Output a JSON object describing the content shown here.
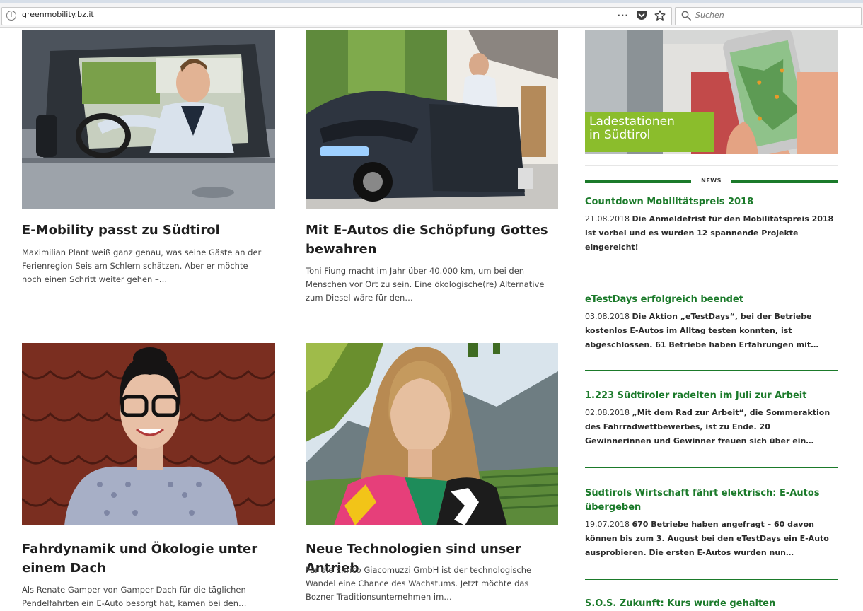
{
  "browser": {
    "url": "greenmobility.bz.it",
    "page_actions": [
      "more-icon",
      "pocket-icon",
      "bookmark-star-icon"
    ],
    "search_placeholder": "Suchen"
  },
  "articles": [
    {
      "title": "E-Mobility passt zu Südtirol",
      "excerpt": "Maximilian Plant weiß ganz genau, was seine Gäste an der Ferienregion Seis am Schlern schätzen. Aber er möchte noch einen Schritt weiter gehen –…"
    },
    {
      "title": "Mit E-Autos die Schöpfung Gottes bewahren",
      "excerpt": "Toni Fiung macht im Jahr über 40.000 km, um bei den Menschen vor Ort zu sein. Eine ökologische(re) Alternative zum Diesel wäre für den…"
    },
    {
      "title": "Fahrdynamik und Ökologie unter einem Dach",
      "excerpt": "Als Renate Gamper von Gamper Dach für die täglichen Pendelfahrten ein E-Auto besorgt hat, kamen bei den…"
    },
    {
      "title": "Neue Technologien sind unser Antrieb",
      "excerpt": "Für die Enrico Giacomuzzi GmbH ist der technologische Wandel eine Chance des Wachstums. Jetzt möchte das Bozner Traditionsunternehmen im…"
    }
  ],
  "sidebar": {
    "banner_line1": "Ladestationen",
    "banner_line2": "in Südtirol",
    "news_label": "NEWS",
    "news": [
      {
        "title": "Countdown Mobilitätspreis 2018",
        "date": "21.08.2018",
        "summary": "Die Anmeldefrist für den Mobilitätspreis 2018 ist vorbei und es wurden 12 spannende Projekte eingereicht!"
      },
      {
        "title": "eTestDays erfolgreich beendet",
        "date": "03.08.2018",
        "summary": "Die Aktion „eTestDays“, bei der Betriebe kostenlos E-Autos im Alltag testen konnten, ist abgeschlossen. 61 Betriebe haben Erfahrungen mit…"
      },
      {
        "title": "1.223 Südtiroler radelten im Juli zur Arbeit",
        "date": "02.08.2018",
        "summary": "„Mit dem Rad zur Arbeit“, die Sommeraktion des Fahrradwettbewerbes, ist zu Ende. 20 Gewinnerinnen und Gewinner freuen sich über ein…"
      },
      {
        "title": "Südtirols Wirtschaft fährt elektrisch: E-Autos übergeben",
        "date": "19.07.2018",
        "summary": "670 Betriebe haben angefragt – 60 davon können bis zum 3. August bei den eTestDays ein E-Auto ausprobieren. Die ersten E-Autos wurden nun…"
      },
      {
        "title": "S.O.S. Zukunft: Kurs wurde gehalten"
      }
    ]
  }
}
